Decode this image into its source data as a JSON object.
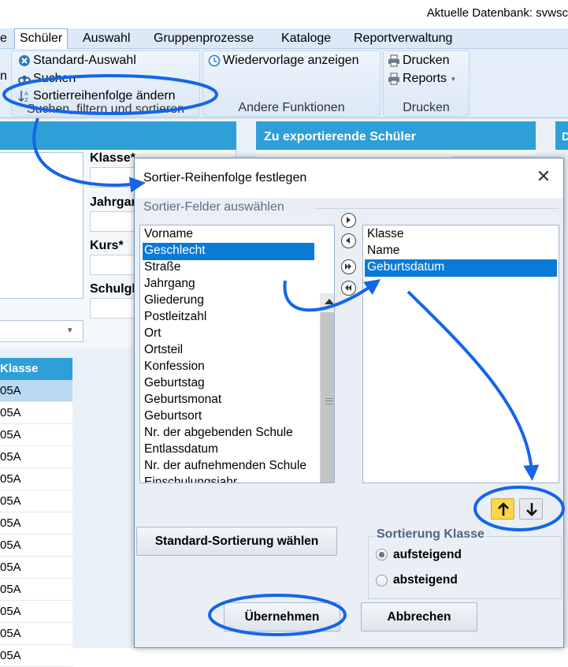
{
  "window": {
    "db_title": "Aktuelle Datenbank: svwsc"
  },
  "menu": [
    "e",
    "Schüler",
    "Auswahl",
    "Gruppenprozesse",
    "Kataloge",
    "Reportverwaltung"
  ],
  "ribbon": {
    "standard_auswahl": "Standard-Auswahl",
    "suchen": "Suchen",
    "sortierreihenfolge": "Sortierreihenfolge ändern",
    "group1_label": "Suchen, filtern und sortieren",
    "wiedervorlage": "Wiedervorlage anzeigen",
    "group2_label": "Andere Funktionen",
    "drucken": "Drucken",
    "reports": "Reports",
    "group3_label": "Drucken",
    "left_edge_char": "n"
  },
  "background": {
    "export_title": "Zu exportierende Schüler",
    "right_panel_letter": "D",
    "labels": {
      "klasse": "Klasse*",
      "jahrgang": "Jahrgar",
      "kurs": "Kurs*",
      "schulgl": "Schulgl"
    },
    "table_header": "Klasse",
    "table_rows": [
      "05A",
      "05A",
      "05A",
      "05A",
      "05A",
      "05A",
      "05A",
      "05A",
      "05A",
      "05A",
      "05A",
      "05A",
      "05A"
    ]
  },
  "dialog": {
    "title": "Sortier-Reihenfolge festlegen",
    "close_glyph": "✕",
    "group_label": "Sortier-Felder auswählen",
    "available_fields": [
      "Vorname",
      "Geschlecht",
      "Straße",
      "Jahrgang",
      "Gliederung",
      "Postleitzahl",
      "Ort",
      "Ortsteil",
      "Konfession",
      "Geburtstag",
      "Geburtsmonat",
      "Geburtsort",
      "Nr. der abgebenden Schule",
      "Entlassdatum",
      "Nr. der aufnehmenden Schule",
      "Einschulungsjahr"
    ],
    "available_selected_index": 1,
    "chosen_fields": [
      "Klasse",
      "Name",
      "Geburtsdatum"
    ],
    "chosen_selected_index": 2,
    "btn_standard": "Standard-Sortierung wählen",
    "sort_group_label": "Sortierung Klasse",
    "radio_asc": "aufsteigend",
    "radio_desc": "absteigend",
    "radio_selected": "aufsteigend",
    "btn_ok": "Übernehmen",
    "btn_cancel": "Abbrechen"
  },
  "colors": {
    "accent_blue": "#2f9fd8",
    "selection_blue": "#0a7ad7",
    "annotation_blue": "#1565e8",
    "up_button_yellow": "#fbd54a"
  }
}
